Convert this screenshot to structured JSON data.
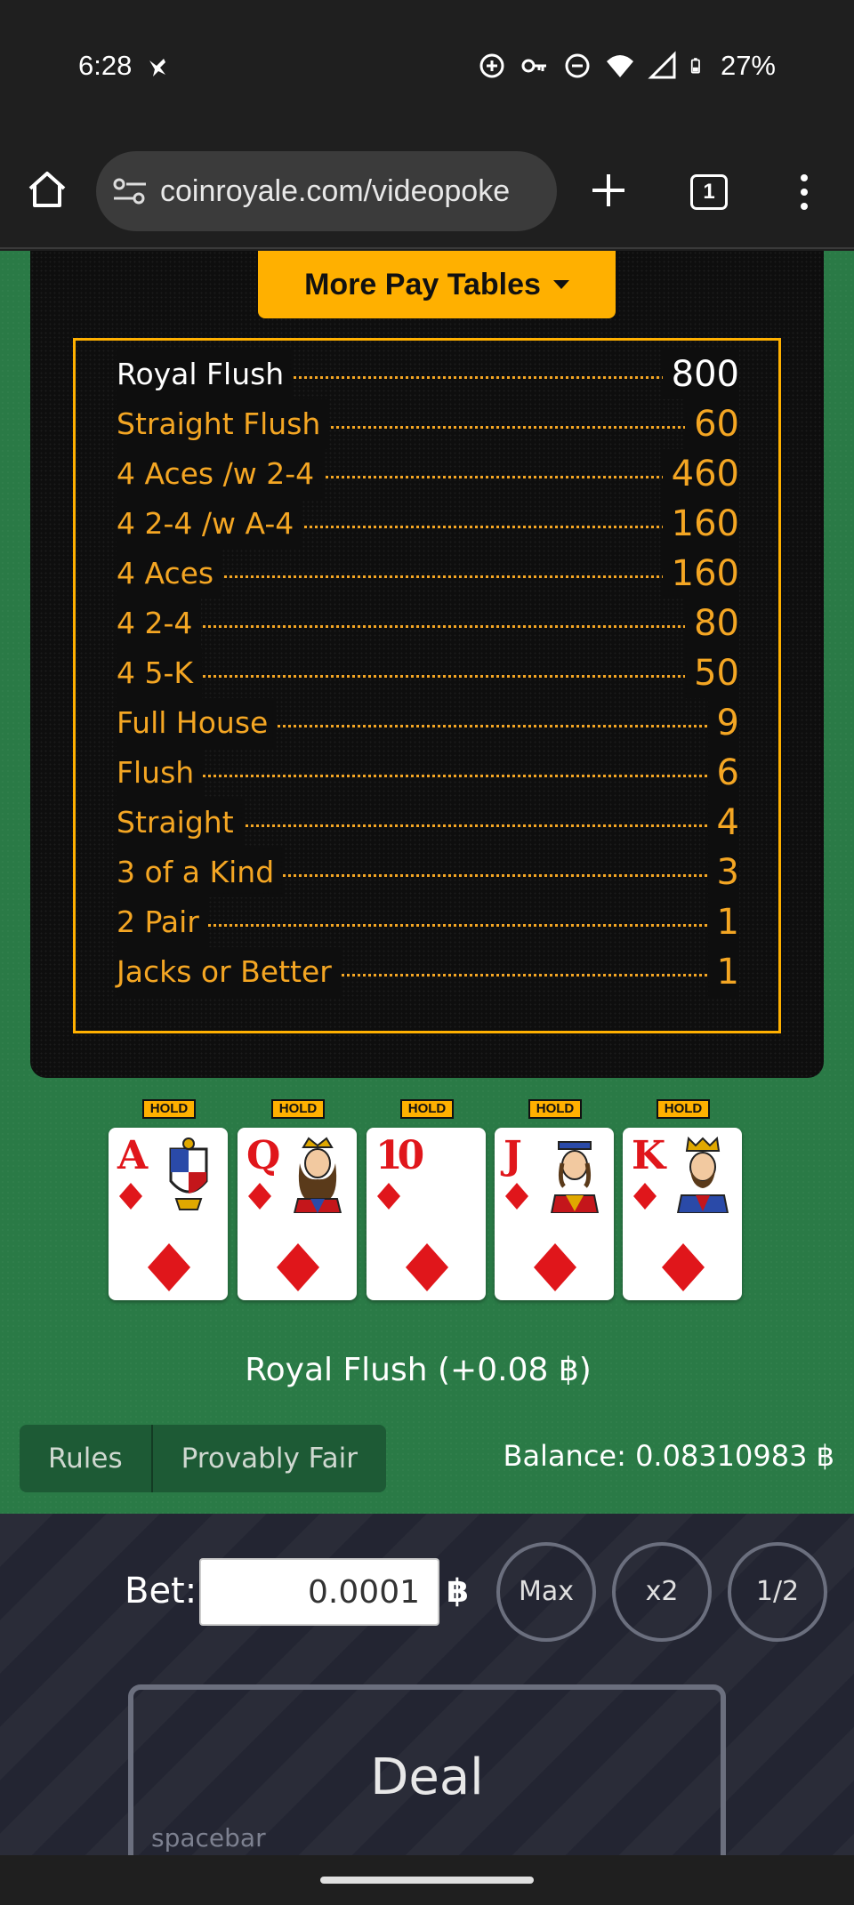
{
  "status_bar": {
    "time": "6:28",
    "battery": "27%"
  },
  "browser": {
    "url": "coinroyale.com/videopoke",
    "tab_count": "1"
  },
  "game": {
    "more_pay_tables_label": "More Pay Tables",
    "pay_table": [
      {
        "hand": "Royal Flush",
        "payout": "800"
      },
      {
        "hand": "Straight Flush",
        "payout": "60"
      },
      {
        "hand": "4 Aces /w 2-4",
        "payout": "460"
      },
      {
        "hand": "4 2-4 /w A-4",
        "payout": "160"
      },
      {
        "hand": "4 Aces",
        "payout": "160"
      },
      {
        "hand": "4 2-4",
        "payout": "80"
      },
      {
        "hand": "4 5-K",
        "payout": "50"
      },
      {
        "hand": "Full House",
        "payout": "9"
      },
      {
        "hand": "Flush",
        "payout": "6"
      },
      {
        "hand": "Straight",
        "payout": "4"
      },
      {
        "hand": "3 of a Kind",
        "payout": "3"
      },
      {
        "hand": "2 Pair",
        "payout": "1"
      },
      {
        "hand": "Jacks or Better",
        "payout": "1"
      }
    ],
    "cards": [
      {
        "rank": "A",
        "suit": "diamond",
        "hold_label": "HOLD"
      },
      {
        "rank": "Q",
        "suit": "diamond",
        "hold_label": "HOLD"
      },
      {
        "rank": "10",
        "suit": "diamond",
        "hold_label": "HOLD"
      },
      {
        "rank": "J",
        "suit": "diamond",
        "hold_label": "HOLD"
      },
      {
        "rank": "K",
        "suit": "diamond",
        "hold_label": "HOLD"
      }
    ],
    "result_text": "Royal Flush (+0.08 ฿)",
    "tabs": [
      "Rules",
      "Provably Fair"
    ],
    "balance_text": "Balance: 0.08310983 ฿"
  },
  "controls": {
    "bet_label": "Bet:",
    "bet_value": "0.0001",
    "currency_symbol": "฿",
    "max_label": "Max",
    "double_label": "x2",
    "half_label": "1/2",
    "deal_label": "Deal",
    "deal_hint": "spacebar"
  },
  "colors": {
    "felt": "#2a7a46",
    "accent": "#ffb000",
    "card_red": "#e0161b"
  }
}
